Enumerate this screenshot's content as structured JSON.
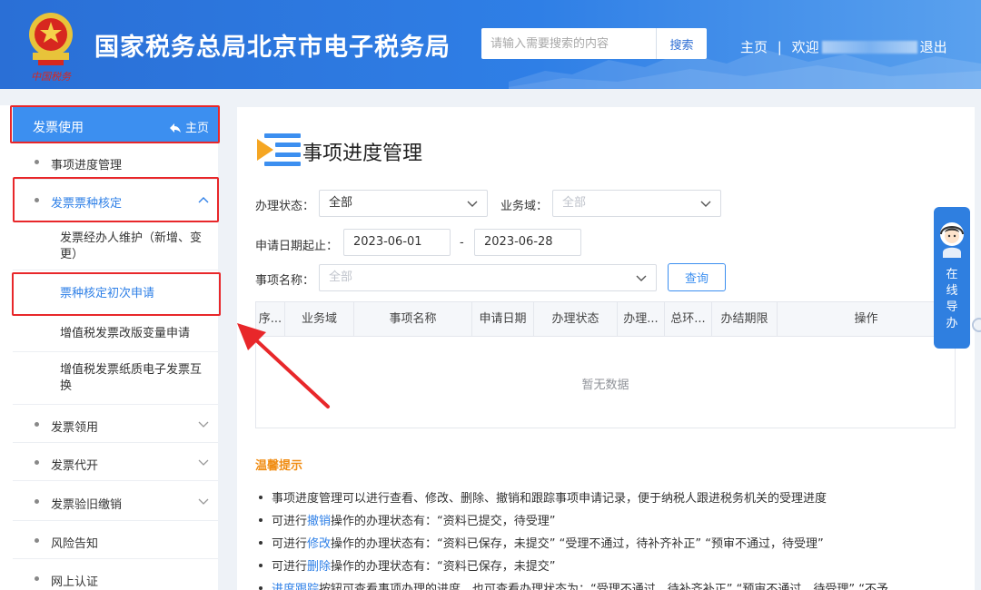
{
  "header": {
    "site_title": "国家税务总局北京市电子税务局",
    "emblem_text": "中国税务",
    "search_placeholder": "请输入需要搜索的内容",
    "search_button": "搜索",
    "home_link": "主页",
    "separator": "|",
    "welcome": "欢迎",
    "logout": "退出"
  },
  "sidebar": {
    "head_title": "发票使用",
    "head_home": "主页",
    "items": [
      {
        "label": "事项进度管理"
      },
      {
        "label": "发票票种核定"
      },
      {
        "label": "发票经办人维护（新增、变更）"
      },
      {
        "label": "票种核定初次申请"
      },
      {
        "label": "增值税发票改版变量申请"
      },
      {
        "label": "增值税发票纸质电子发票互换"
      },
      {
        "label": "发票领用"
      },
      {
        "label": "发票代开"
      },
      {
        "label": "发票验旧缴销"
      },
      {
        "label": "风险告知"
      },
      {
        "label": "网上认证"
      }
    ]
  },
  "main": {
    "title": "事项进度管理",
    "form": {
      "status_label": "办理状态：",
      "status_value": "全部",
      "domain_label": "业务域：",
      "domain_placeholder": "全部",
      "date_label": "申请日期起止：",
      "date_start": "2023-06-01",
      "date_sep": "-",
      "date_end": "2023-06-28",
      "name_label": "事项名称：",
      "name_placeholder": "全部",
      "query_button": "查询"
    },
    "table": {
      "columns": [
        "序...",
        "业务域",
        "事项名称",
        "申请日期",
        "办理状态",
        "办理...",
        "总环...",
        "办结期限",
        "操作"
      ],
      "empty_text": "暂无数据"
    },
    "tips": {
      "title": "温馨提示",
      "lines": [
        {
          "pre": "事项进度管理可以进行查看、修改、删除、撤销和跟踪事项申请记录，便于纳税人跟进税务机关的受理进度",
          "hl": "",
          "post": ""
        },
        {
          "pre": "可进行",
          "hl": "撤销",
          "post": "操作的办理状态有：“资料已提交，待受理”"
        },
        {
          "pre": "可进行",
          "hl": "修改",
          "post": "操作的办理状态有：“资料已保存，未提交”   “受理不通过，待补齐补正”   “预审不通过，待受理”"
        },
        {
          "pre": "可进行",
          "hl": "删除",
          "post": "操作的办理状态有：“资料已保存，未提交”"
        },
        {
          "pre": "",
          "hl": "进度跟踪",
          "post": "按钮可查看事项办理的进度，也可查看办理状态为：“受理不通过，待补齐补正”   “预审不通过，待受理”   “不予"
        }
      ]
    }
  },
  "help_widget": {
    "label": "在线导办"
  },
  "colors": {
    "header_blue": "#2f7fe6",
    "accent_blue": "#3c8ff0",
    "highlight_red": "#e8272a",
    "tips_orange": "#f08c12"
  }
}
